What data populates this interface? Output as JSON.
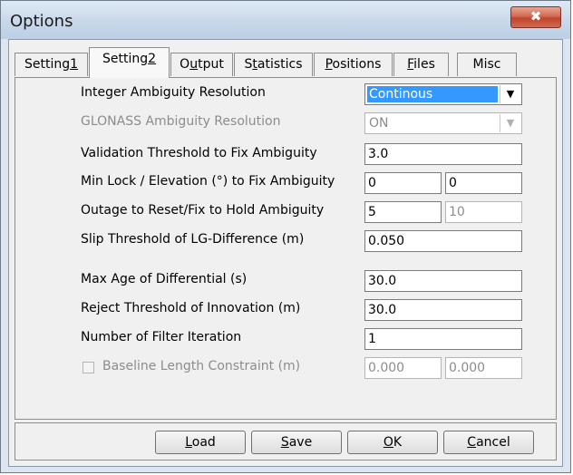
{
  "window": {
    "title": "Options",
    "close_glyph": "✖"
  },
  "tabs": [
    {
      "pre": "Setting",
      "key": "1",
      "post": ""
    },
    {
      "pre": "Setting",
      "key": "2",
      "post": ""
    },
    {
      "pre": "O",
      "key": "u",
      "post": "tput"
    },
    {
      "pre": "S",
      "key": "t",
      "post": "atistics"
    },
    {
      "pre": "",
      "key": "P",
      "post": "ositions"
    },
    {
      "pre": "",
      "key": "F",
      "post": "iles"
    },
    {
      "pre": "Misc",
      "key": "",
      "post": ""
    }
  ],
  "settings": {
    "integer_ambiguity": {
      "label": "Integer Ambiguity Resolution",
      "value": "Continous"
    },
    "glonass_ambiguity": {
      "label": "GLONASS Ambiguity Resolution",
      "value": "ON"
    },
    "validation_threshold": {
      "label": "Validation Threshold to Fix Ambiguity",
      "value": "3.0"
    },
    "min_lock": {
      "label": "Min Lock / Elevation (°) to Fix Ambiguity",
      "value1": "0",
      "value2": "0"
    },
    "outage": {
      "label": "Outage to Reset/Fix to Hold Ambiguity",
      "value1": "5",
      "value2": "10"
    },
    "slip_threshold": {
      "label": "Slip Threshold of LG-Difference (m)",
      "value": "0.050"
    },
    "max_age": {
      "label": "Max Age of Differential (s)",
      "value": "30.0"
    },
    "reject_threshold": {
      "label": "Reject Threshold of Innovation (m)",
      "value": "30.0"
    },
    "filter_iteration": {
      "label": "Number of Filter Iteration",
      "value": "1"
    },
    "baseline": {
      "label": "Baseline Length Constraint (m)",
      "value1": "0.000",
      "value2": "0.000",
      "checked": false
    }
  },
  "buttons": {
    "load": {
      "key": "L",
      "post": "oad"
    },
    "save": {
      "key": "S",
      "post": "ave"
    },
    "ok": {
      "key": "O",
      "post": "K"
    },
    "cancel": {
      "key": "C",
      "post": "ancel"
    }
  },
  "icons": {
    "dropdown": "chevron-down-icon",
    "close": "close-icon"
  }
}
